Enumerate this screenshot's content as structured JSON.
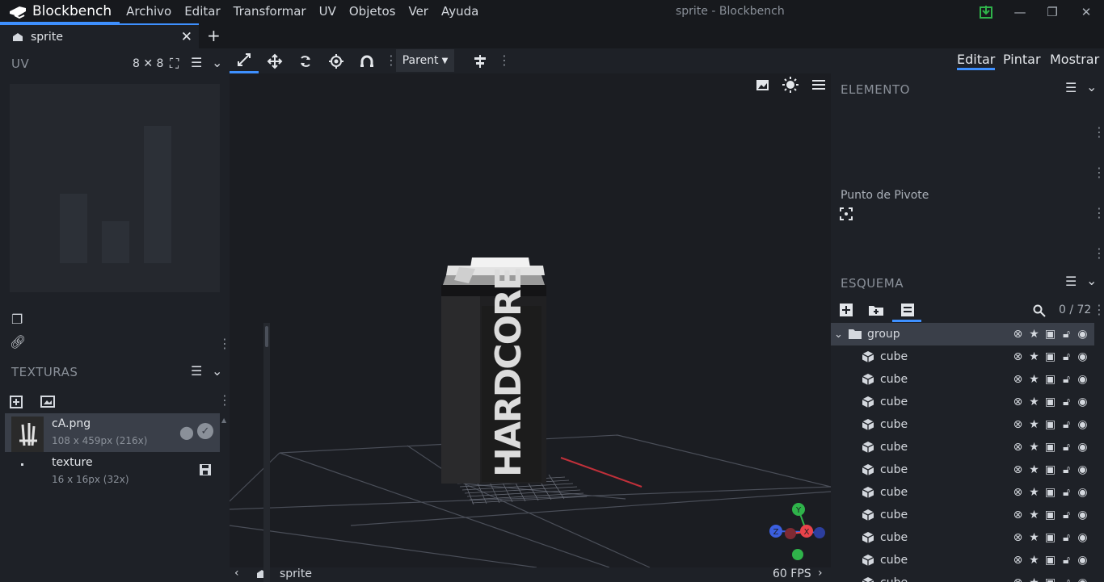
{
  "app": {
    "name": "Blockbench",
    "window_title": "sprite - Blockbench",
    "menu": [
      "Archivo",
      "Editar",
      "Transformar",
      "UV",
      "Objetos",
      "Ver",
      "Ayuda"
    ]
  },
  "tabs": {
    "open": [
      {
        "label": "sprite"
      }
    ],
    "add_label": "+"
  },
  "uv_panel": {
    "title": "UV",
    "size_label": "8 ✕ 8"
  },
  "textures_panel": {
    "title": "TEXTURAS",
    "items": [
      {
        "name": "cA.png",
        "size": "108 x 459px (216x)",
        "selected": true
      },
      {
        "name": "texture",
        "size": "16 x 16px (32x)",
        "selected": false
      }
    ]
  },
  "toolbar": {
    "parent_label": "Parent",
    "tools": [
      "move-tool",
      "resize-tool",
      "rotate-tool",
      "pivot-tool",
      "vertex-snap-tool"
    ]
  },
  "viewport": {
    "model_text": "HARDCORE",
    "footer_name": "sprite",
    "fps": "60 FPS",
    "gizmo": {
      "x_label": "X",
      "y_label": "Y",
      "z_label": "Z"
    }
  },
  "modes": [
    {
      "label": "Editar",
      "active": true
    },
    {
      "label": "Pintar",
      "active": false
    },
    {
      "label": "Mostrar",
      "active": false
    }
  ],
  "element_panel": {
    "title": "ELEMENTO",
    "pivot_label": "Punto de Pivote"
  },
  "outliner": {
    "title": "ESQUEMA",
    "count": "0 / 72",
    "group": "group",
    "items": [
      "cube",
      "cube",
      "cube",
      "cube",
      "cube",
      "cube",
      "cube",
      "cube",
      "cube",
      "cube",
      "cube"
    ]
  },
  "colors": {
    "accent": "#3e90ff",
    "background": "#1e2127",
    "titlebar": "#17191d",
    "selected": "#3a3f49",
    "gizmo_x": "#e9434a",
    "gizmo_y": "#2fb34a",
    "gizmo_z": "#3b5fe0"
  }
}
